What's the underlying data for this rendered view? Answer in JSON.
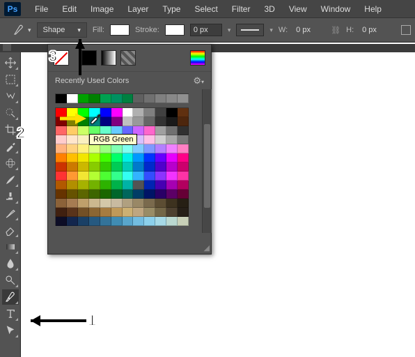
{
  "logo": "Ps",
  "menu": [
    "File",
    "Edit",
    "Image",
    "Layer",
    "Type",
    "Select",
    "Filter",
    "3D",
    "View",
    "Window",
    "Help"
  ],
  "options": {
    "mode_label": "Shape",
    "fill_label": "Fill:",
    "fill_color": "#ffffff",
    "stroke_label": "Stroke:",
    "stroke_color": "#ffffff",
    "stroke_width": "0 px",
    "w_label": "W:",
    "w_value": "0 px",
    "h_label": "H:",
    "h_value": "0 px"
  },
  "panel": {
    "title": "Recently Used Colors",
    "tooltip": "RGB Green",
    "recent_colors": [
      "#000000",
      "#ffffff",
      "#00a000",
      "#008000",
      "#00a050",
      "#009060",
      "#008040",
      "#606060",
      "#707070",
      "#808080",
      "#888888",
      "#909090"
    ],
    "grid_colors": [
      [
        "#ff0000",
        "#ffff00",
        "#00ff00",
        "#00ffff",
        "#0000ff",
        "#ff00ff",
        "#ffffff",
        "#b0b0b0",
        "#808080",
        "#404040",
        "#000000",
        "#603010"
      ],
      [
        "#800000",
        "#808000",
        "#008000",
        "#008080",
        "#000080",
        "#800080",
        "#c0c0c0",
        "#999999",
        "#666666",
        "#333333",
        "#1a1a1a",
        "#4d260d"
      ],
      [
        "#ff6666",
        "#ffcc66",
        "#ccff66",
        "#66ff66",
        "#66ffcc",
        "#66ccff",
        "#6666ff",
        "#cc66ff",
        "#ff66cc",
        "#a0a0a0",
        "#707070",
        "#303030"
      ],
      [
        "#ffcccc",
        "#ffe6cc",
        "#faf0c0",
        "#e0ffc0",
        "#c0ffd0",
        "#c0f0ff",
        "#c0d0ff",
        "#d8c0ff",
        "#ffc0e6",
        "#d0d0d0",
        "#a8a8a8",
        "#787878"
      ],
      [
        "#ffb380",
        "#ffd280",
        "#fff080",
        "#d9ff80",
        "#99ff80",
        "#80ffb3",
        "#80fff0",
        "#80ccff",
        "#8099ff",
        "#b380ff",
        "#f080ff",
        "#ff80c4"
      ],
      [
        "#ff8000",
        "#ffbf00",
        "#f2e600",
        "#aaff00",
        "#40ff00",
        "#00ff6a",
        "#00f2e6",
        "#0099ff",
        "#0033ff",
        "#6600ff",
        "#e600ff",
        "#ff0088"
      ],
      [
        "#cc3300",
        "#cc7a00",
        "#ccb800",
        "#88cc00",
        "#33cc00",
        "#00cc55",
        "#00ccb8",
        "#007acc",
        "#0029cc",
        "#5200cc",
        "#b800cc",
        "#cc006d"
      ],
      [
        "#ff3333",
        "#ff9933",
        "#f2e633",
        "#b3ff33",
        "#4dff33",
        "#33ff8c",
        "#33fff2",
        "#33b3ff",
        "#334dff",
        "#8c33ff",
        "#f233ff",
        "#ff33a6"
      ],
      [
        "#b25900",
        "#b28f00",
        "#a6b200",
        "#73b200",
        "#2db200",
        "#00b24a",
        "#00b2a6",
        "#006bb200",
        "#0024b2",
        "#4700b2",
        "#a600b2",
        "#b2005f"
      ],
      [
        "#663300",
        "#665200",
        "#5c6600",
        "#3d6600",
        "#1a6600",
        "#00662b",
        "#00665c",
        "#003d66",
        "#001466",
        "#290066",
        "#5c0066",
        "#660036"
      ],
      [
        "#8c6239",
        "#a67c52",
        "#bfa06b",
        "#ccb88f",
        "#d4c8a8",
        "#c8baa0",
        "#b0a080",
        "#998866",
        "#7a6a4d",
        "#5c4d33",
        "#3d321f",
        "#261f14"
      ],
      [
        "#402010",
        "#59331a",
        "#735026",
        "#8c6633",
        "#a67c40",
        "#bf9959",
        "#ccb073",
        "#bfa680",
        "#998c66",
        "#736647",
        "#4d4030",
        "#261f18"
      ],
      [
        "#0d0d26",
        "#13264d",
        "#1a4066",
        "#265980",
        "#337399",
        "#408cb3",
        "#59a6cc",
        "#73bde0",
        "#8cd0eb",
        "#a6d9e6",
        "#bad8d0",
        "#c8d0b8"
      ]
    ]
  },
  "annotations": {
    "n1": "1",
    "n2": "2",
    "n3": "3"
  }
}
